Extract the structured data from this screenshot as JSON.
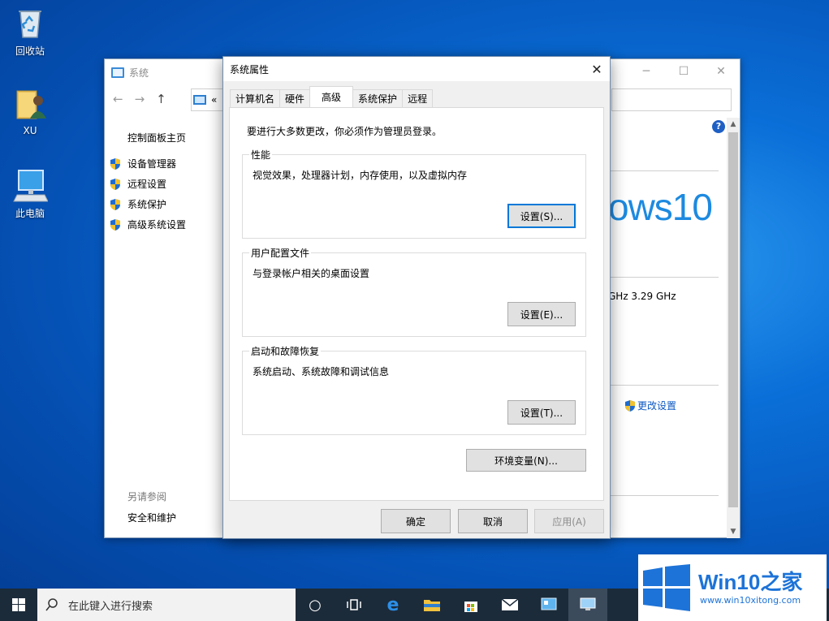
{
  "desktop": {
    "icons": [
      {
        "label": "回收站"
      },
      {
        "label": "XU"
      },
      {
        "label": "此电脑"
      }
    ]
  },
  "system_window": {
    "title": "系统",
    "address_fragment": "«",
    "control_panel_home": "控制面板主页",
    "links": [
      "设备管理器",
      "远程设置",
      "系统保护",
      "高级系统设置"
    ],
    "see_also": "另请参阅",
    "security": "安全和维护",
    "logo_text": "ows10",
    "ghz_text": "GHz   3.29 GHz",
    "change_settings": "更改设置",
    "help": "?"
  },
  "dialog": {
    "title": "系统属性",
    "tabs": [
      "计算机名",
      "硬件",
      "高级",
      "系统保护",
      "远程"
    ],
    "active_tab": "高级",
    "admin_note": "要进行大多数更改，你必须作为管理员登录。",
    "groups": [
      {
        "label": "性能",
        "desc": "视觉效果，处理器计划，内存使用，以及虚拟内存",
        "button": "设置(S)..."
      },
      {
        "label": "用户配置文件",
        "desc": "与登录帐户相关的桌面设置",
        "button": "设置(E)..."
      },
      {
        "label": "启动和故障恢复",
        "desc": "系统启动、系统故障和调试信息",
        "button": "设置(T)..."
      }
    ],
    "env_button": "环境变量(N)...",
    "ok": "确定",
    "cancel": "取消",
    "apply": "应用(A)"
  },
  "taskbar": {
    "search_placeholder": "在此键入进行搜索"
  },
  "watermark": {
    "title_latin": "Win10",
    "title_cn": "之家",
    "url": "www.win10xitong.com"
  },
  "colors": {
    "accent": "#0078d7",
    "link": "#0b57c2",
    "win10_blue": "#1d8ae0"
  }
}
